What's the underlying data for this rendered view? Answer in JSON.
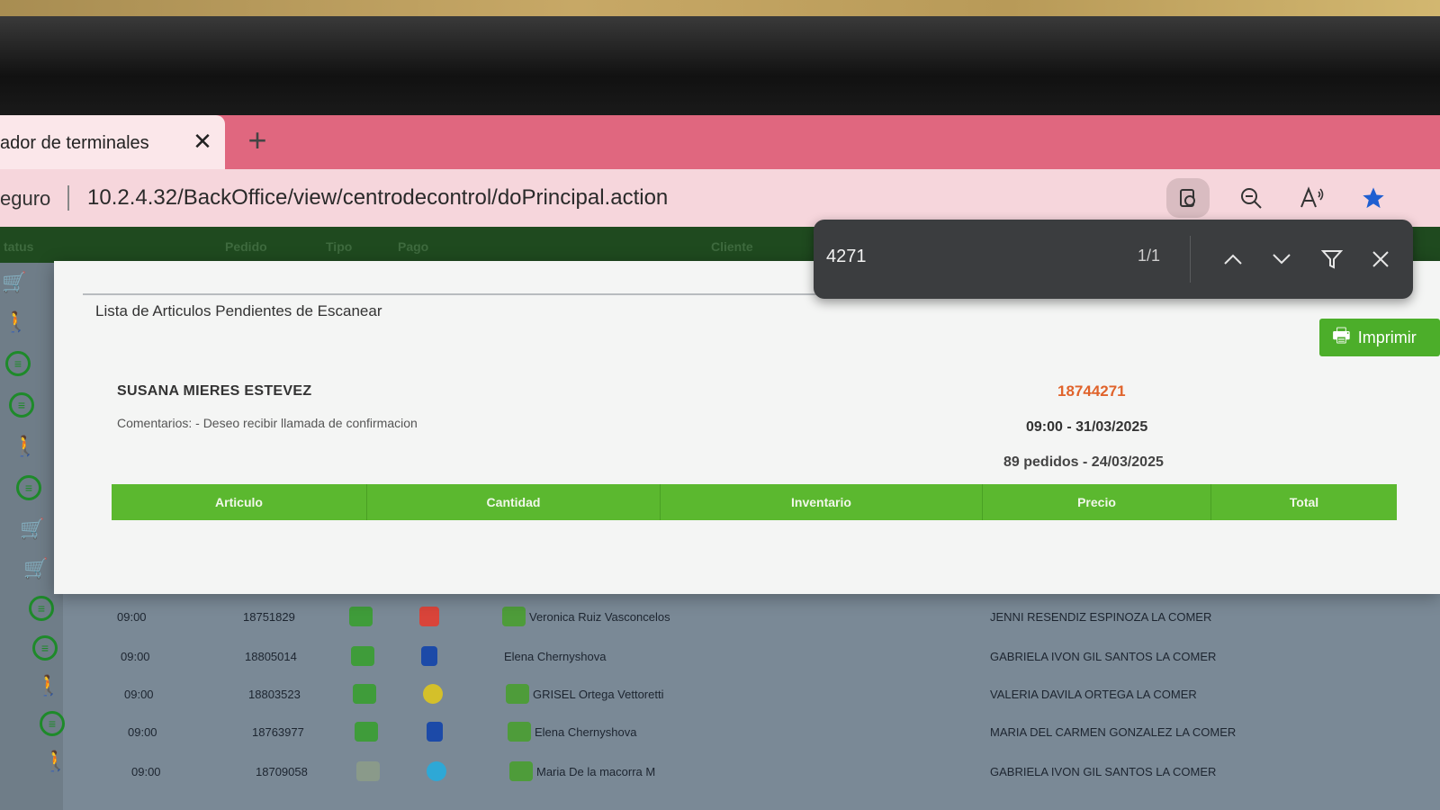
{
  "browser": {
    "tab_title": "ador de terminales",
    "tab_close": "✕",
    "new_tab": "+",
    "secure_label": "eguro",
    "url": "10.2.4.32/BackOffice/view/centrodecontrol/doPrincipal.action"
  },
  "find_bar": {
    "query": "4271",
    "match_count": "1/1"
  },
  "list_header": [
    "tatus",
    "Pedido",
    "Tipo",
    "Pago",
    "Cliente"
  ],
  "modal": {
    "title": "Lista de Articulos Pendientes de Escanear",
    "print_label": "Imprimir",
    "customer_name": "SUSANA MIERES ESTEVEZ",
    "comments": "Comentarios:  - Deseo recibir llamada de confirmacion",
    "order_number": "18744271",
    "delivery": "09:00 - 31/03/2025",
    "orders_info": "89 pedidos - 24/03/2025",
    "columns": [
      "Articulo",
      "Cantidad",
      "Inventario",
      "Precio",
      "Total"
    ]
  },
  "rows": [
    {
      "time": "09:00",
      "order": "18751829",
      "client": "Veronica Ruiz Vasconcelos",
      "picker": "JENNI RESENDIZ ESPINOZA LA COMER",
      "pay_color": "#d9443a"
    },
    {
      "time": "09:00",
      "order": "18805014",
      "client": "Elena Chernyshova",
      "picker": "GABRIELA IVON GIL SANTOS LA COMER",
      "pay_color": "#1c4aa8"
    },
    {
      "time": "09:00",
      "order": "18803523",
      "client": "GRISEL Ortega Vettoretti",
      "picker": "VALERIA DAVILA ORTEGA LA COMER",
      "pay_color": "#d4c02a"
    },
    {
      "time": "09:00",
      "order": "18763977",
      "client": "Elena Chernyshova",
      "picker": "MARIA DEL CARMEN GONZALEZ LA COMER",
      "pay_color": "#1c4aa8"
    },
    {
      "time": "09:00",
      "order": "18709058",
      "client": "Maria De la macorra M",
      "picker": "GABRIELA IVON GIL SANTOS LA COMER",
      "pay_color": "#2ea8d6"
    }
  ],
  "colors": {
    "tab_strip": "#e0677f",
    "accent_green": "#5bb82f",
    "order_number": "#e0632b"
  }
}
